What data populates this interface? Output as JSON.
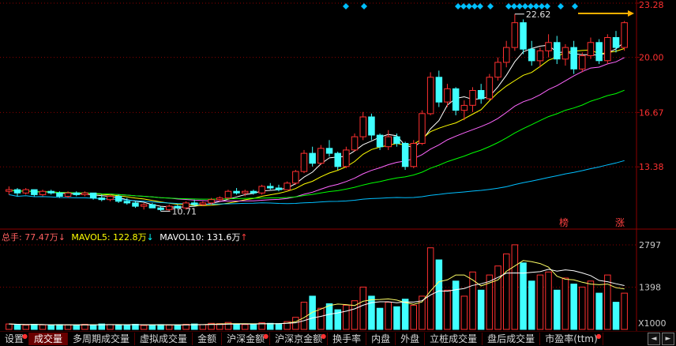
{
  "chart_data": [
    {
      "type": "candlestick",
      "price_ticks": [
        "23.28",
        "20.00",
        "16.67",
        "13.38"
      ],
      "annotations": {
        "high_label": "22.62",
        "low_label": "10.71",
        "badge_1": "榜",
        "badge_2": "涨"
      },
      "price_range": [
        10.0,
        23.28
      ],
      "candles": [
        [
          11.9,
          12.2,
          11.7,
          12.0
        ],
        [
          12.0,
          12.1,
          11.6,
          11.8
        ],
        [
          11.8,
          12.1,
          11.7,
          12.0
        ],
        [
          12.0,
          12.0,
          11.6,
          11.7
        ],
        [
          11.7,
          12.0,
          11.6,
          11.9
        ],
        [
          11.9,
          12.0,
          11.7,
          11.8
        ],
        [
          11.8,
          11.9,
          11.5,
          11.6
        ],
        [
          11.6,
          11.9,
          11.5,
          11.8
        ],
        [
          11.8,
          11.9,
          11.6,
          11.7
        ],
        [
          11.7,
          11.9,
          11.6,
          11.8
        ],
        [
          11.8,
          11.8,
          11.4,
          11.5
        ],
        [
          11.5,
          11.7,
          11.3,
          11.4
        ],
        [
          11.4,
          11.7,
          11.3,
          11.6
        ],
        [
          11.6,
          11.7,
          11.2,
          11.3
        ],
        [
          11.3,
          11.5,
          11.1,
          11.2
        ],
        [
          11.2,
          11.3,
          10.9,
          11.0
        ],
        [
          11.0,
          11.2,
          10.8,
          11.1
        ],
        [
          11.1,
          11.2,
          10.9,
          10.9
        ],
        [
          10.9,
          11.0,
          10.7,
          10.8
        ],
        [
          10.8,
          11.1,
          10.71,
          11.0
        ],
        [
          11.0,
          11.1,
          10.8,
          10.9
        ],
        [
          10.9,
          11.3,
          10.8,
          11.2
        ],
        [
          11.2,
          11.4,
          11.0,
          11.1
        ],
        [
          11.1,
          11.3,
          11.0,
          11.2
        ],
        [
          11.2,
          11.5,
          11.1,
          11.4
        ],
        [
          11.4,
          11.6,
          11.3,
          11.5
        ],
        [
          11.5,
          12.0,
          11.4,
          11.9
        ],
        [
          11.9,
          12.1,
          11.7,
          11.8
        ],
        [
          11.8,
          12.0,
          11.6,
          11.9
        ],
        [
          11.9,
          12.0,
          11.7,
          11.8
        ],
        [
          11.8,
          12.3,
          11.7,
          12.2
        ],
        [
          12.2,
          12.4,
          12.0,
          12.1
        ],
        [
          12.1,
          12.3,
          11.9,
          12.0
        ],
        [
          12.0,
          12.5,
          12.0,
          12.4
        ],
        [
          12.4,
          13.2,
          12.3,
          13.1
        ],
        [
          13.1,
          14.4,
          13.0,
          14.2
        ],
        [
          14.2,
          14.6,
          13.4,
          13.6
        ],
        [
          13.6,
          14.7,
          13.5,
          14.5
        ],
        [
          14.5,
          15.0,
          14.0,
          14.2
        ],
        [
          14.2,
          14.3,
          13.2,
          13.4
        ],
        [
          13.4,
          14.6,
          13.3,
          14.4
        ],
        [
          14.4,
          15.4,
          14.3,
          15.2
        ],
        [
          15.2,
          16.7,
          15.0,
          16.4
        ],
        [
          16.4,
          16.6,
          15.0,
          15.3
        ],
        [
          15.3,
          15.4,
          14.4,
          14.6
        ],
        [
          14.6,
          15.6,
          14.4,
          15.2
        ],
        [
          15.2,
          15.4,
          14.6,
          14.8
        ],
        [
          14.8,
          14.9,
          13.2,
          13.4
        ],
        [
          13.4,
          15.0,
          13.3,
          14.8
        ],
        [
          14.8,
          16.8,
          14.7,
          16.6
        ],
        [
          16.6,
          19.1,
          16.5,
          18.8
        ],
        [
          18.8,
          19.2,
          17.0,
          17.3
        ],
        [
          17.3,
          18.4,
          17.0,
          18.1
        ],
        [
          18.1,
          18.2,
          16.5,
          16.8
        ],
        [
          16.8,
          17.4,
          16.2,
          17.1
        ],
        [
          17.1,
          18.2,
          16.7,
          18.0
        ],
        [
          18.0,
          18.4,
          17.2,
          17.5
        ],
        [
          17.5,
          19.0,
          17.4,
          18.8
        ],
        [
          18.8,
          20.0,
          18.6,
          19.7
        ],
        [
          19.7,
          21.0,
          19.4,
          20.6
        ],
        [
          20.6,
          22.62,
          20.4,
          22.1
        ],
        [
          22.1,
          22.3,
          20.2,
          20.5
        ],
        [
          20.5,
          21.0,
          19.5,
          19.8
        ],
        [
          19.8,
          20.6,
          19.4,
          20.4
        ],
        [
          20.4,
          21.4,
          20.0,
          20.9
        ],
        [
          20.9,
          21.3,
          19.6,
          19.9
        ],
        [
          19.9,
          20.8,
          19.5,
          20.6
        ],
        [
          20.6,
          21.0,
          19.0,
          19.3
        ],
        [
          19.3,
          20.3,
          19.1,
          20.1
        ],
        [
          20.1,
          21.2,
          19.9,
          20.9
        ],
        [
          20.9,
          21.1,
          19.6,
          19.8
        ],
        [
          19.8,
          21.4,
          19.6,
          21.2
        ],
        [
          21.2,
          21.6,
          20.3,
          20.6
        ],
        [
          20.6,
          22.2,
          20.4,
          22.1
        ]
      ],
      "ma_series": [
        {
          "color": "#ffffff"
        },
        {
          "color": "#ffff00"
        },
        {
          "color": "#ff66ff"
        },
        {
          "color": "#00ff00"
        },
        {
          "color": "#00bfff"
        }
      ]
    },
    {
      "type": "bar",
      "volume_ticks": [
        "2797",
        "1398",
        "X1000"
      ],
      "volume_max": 2797,
      "volumes": [
        180,
        160,
        140,
        170,
        150,
        130,
        160,
        150,
        140,
        170,
        150,
        180,
        160,
        140,
        150,
        170,
        130,
        150,
        160,
        140,
        150,
        170,
        180,
        160,
        200,
        190,
        230,
        170,
        160,
        180,
        220,
        200,
        190,
        260,
        400,
        900,
        1100,
        700,
        850,
        650,
        800,
        950,
        1400,
        1100,
        700,
        900,
        750,
        1000,
        800,
        1100,
        2700,
        2300,
        1300,
        1600,
        1100,
        1900,
        1300,
        1800,
        2100,
        2500,
        2800,
        2200,
        1600,
        1800,
        1900,
        1300,
        1700,
        1500,
        1400,
        1600,
        1200,
        1800,
        900,
        1200
      ],
      "ma_colors": {
        "ma5": "#ffff66",
        "ma10": "#ffffff"
      },
      "stats": {
        "total": {
          "label": "总手: 77.47万",
          "arrow": "↓",
          "color": "#ff6060",
          "arrow_color": "#ff6060"
        },
        "mavol5": {
          "label": "MAVOL5: 122.8万",
          "arrow": "↓",
          "color": "#ffff00",
          "arrow_color": "#00ffff"
        },
        "mavol10": {
          "label": "MAVOL10: 131.6万",
          "arrow": "↑",
          "color": "#ffffff",
          "arrow_color": "#ff4040"
        }
      }
    }
  ],
  "colors": {
    "up": "#ff3030",
    "down": "#40ffff",
    "grid": "#8b0000",
    "axis_text": "#c8c8c8",
    "marker": "#00bfff",
    "annotation_arrow": "#ffb000"
  },
  "tabs": [
    "设置",
    "成交量",
    "多周期成交量",
    "虚拟成交量",
    "金额",
    "沪深金额",
    "沪深京金额",
    "换手率",
    "内盘",
    "外盘",
    "立桩成交量",
    "盘后成交量",
    "市盈率(ttm)"
  ],
  "active_tab": "成交量",
  "nav": {
    "prev": "◄",
    "next": "►"
  }
}
